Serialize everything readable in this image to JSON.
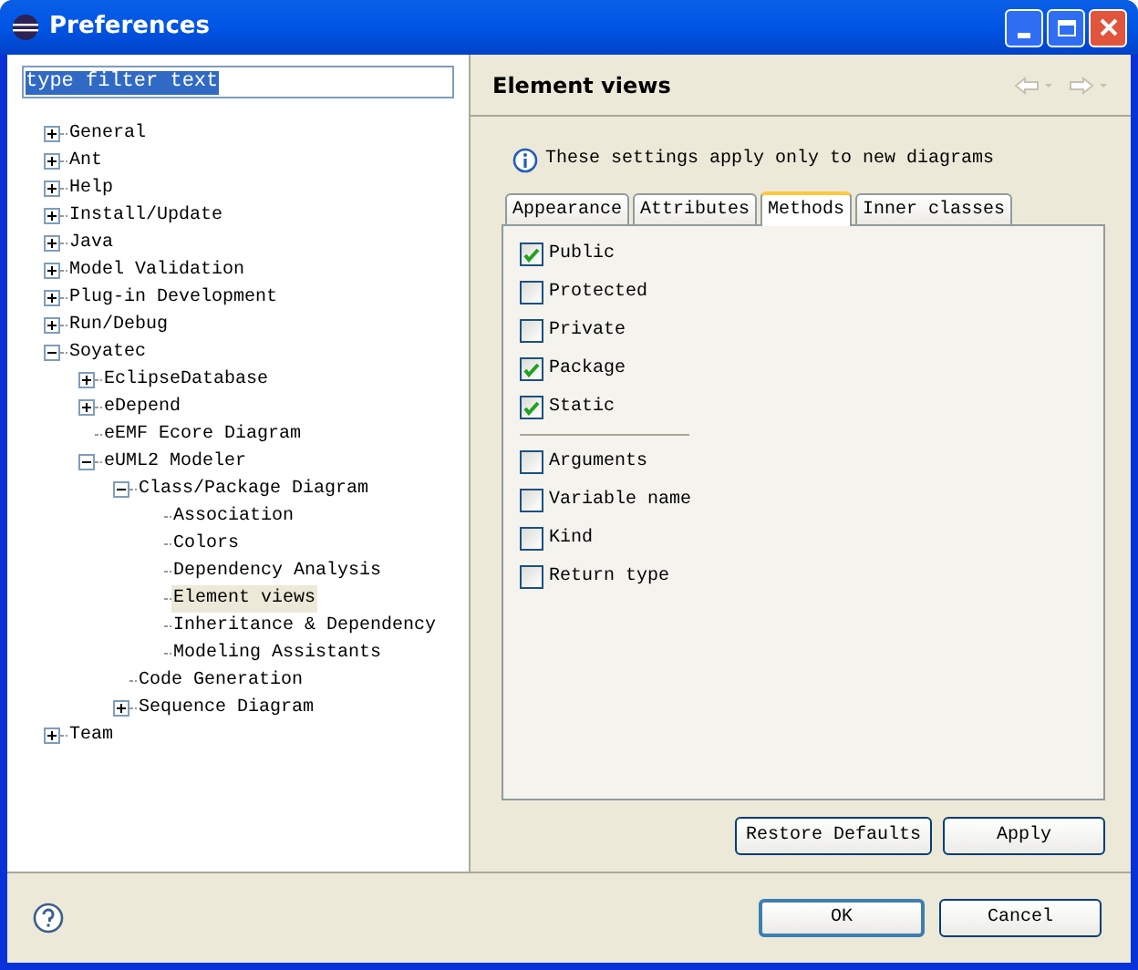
{
  "window": {
    "title": "Preferences"
  },
  "filter": {
    "value": "type filter text"
  },
  "tree": [
    {
      "label": "General",
      "expanded": false,
      "selected": false
    },
    {
      "label": "Ant",
      "expanded": false,
      "selected": false
    },
    {
      "label": "Help",
      "expanded": false,
      "selected": false
    },
    {
      "label": "Install/Update",
      "expanded": false,
      "selected": false
    },
    {
      "label": "Java",
      "expanded": false,
      "selected": false
    },
    {
      "label": "Model Validation",
      "expanded": false,
      "selected": false
    },
    {
      "label": "Plug-in Development",
      "expanded": false,
      "selected": false
    },
    {
      "label": "Run/Debug",
      "expanded": false,
      "selected": false
    },
    {
      "label": "Soyatec",
      "expanded": true,
      "selected": false,
      "children": [
        {
          "label": "EclipseDatabase",
          "expanded": false,
          "selected": false
        },
        {
          "label": "eDepend",
          "expanded": false,
          "selected": false
        },
        {
          "label": "eEMF Ecore Diagram",
          "selected": false
        },
        {
          "label": "eUML2 Modeler",
          "expanded": true,
          "selected": false,
          "children": [
            {
              "label": "Class/Package Diagram",
              "expanded": true,
              "selected": false,
              "children": [
                {
                  "label": "Association",
                  "selected": false
                },
                {
                  "label": "Colors",
                  "selected": false
                },
                {
                  "label": "Dependency Analysis",
                  "selected": false
                },
                {
                  "label": "Element views",
                  "selected": true
                },
                {
                  "label": "Inheritance & Dependency",
                  "selected": false
                },
                {
                  "label": "Modeling Assistants",
                  "selected": false
                }
              ]
            },
            {
              "label": "Code Generation",
              "selected": false
            },
            {
              "label": "Sequence Diagram",
              "expanded": false,
              "selected": false
            }
          ]
        }
      ]
    },
    {
      "label": "Team",
      "expanded": false,
      "selected": false
    }
  ],
  "page": {
    "title": "Element views",
    "info": "These settings apply only to new diagrams",
    "tabs": [
      {
        "label": "Appearance",
        "selected": false
      },
      {
        "label": "Attributes",
        "selected": false
      },
      {
        "label": "Methods",
        "selected": true
      },
      {
        "label": "Inner classes",
        "selected": false
      }
    ],
    "visibility_options": [
      {
        "label": "Public",
        "checked": true
      },
      {
        "label": "Protected",
        "checked": false
      },
      {
        "label": "Private",
        "checked": false
      },
      {
        "label": "Package",
        "checked": true
      },
      {
        "label": "Static",
        "checked": true
      }
    ],
    "detail_options": [
      {
        "label": "Arguments",
        "checked": false
      },
      {
        "label": "Variable name",
        "checked": false
      },
      {
        "label": "Kind",
        "checked": false
      },
      {
        "label": "Return type",
        "checked": false
      }
    ],
    "buttons": [
      "Restore Defaults",
      "Apply"
    ]
  },
  "dialog_buttons": [
    "OK",
    "Cancel"
  ]
}
